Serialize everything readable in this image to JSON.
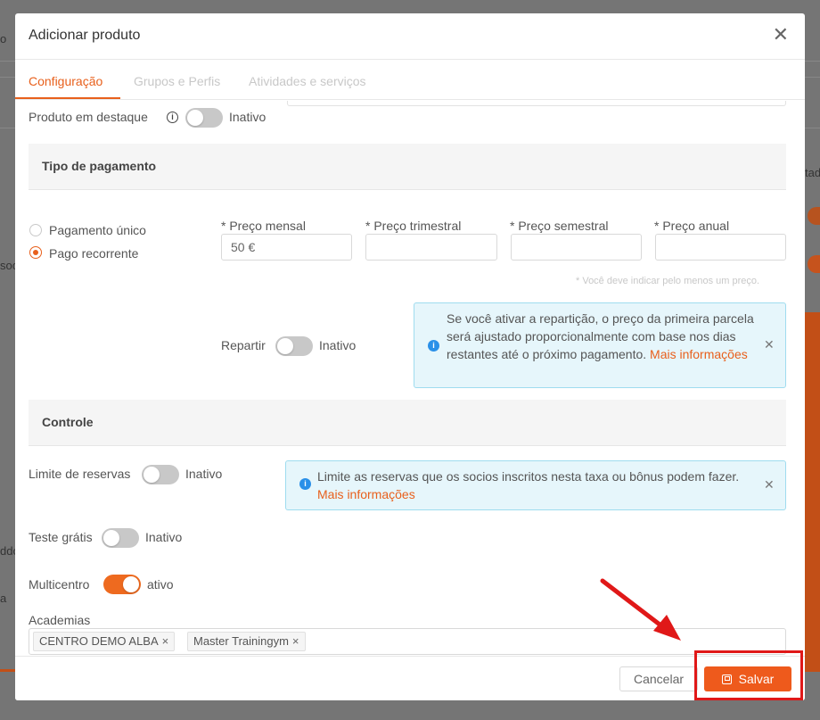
{
  "background": {
    "fragments": [
      {
        "text": "o",
        "id": "bg-text-1"
      },
      {
        "text": "soc",
        "id": "bg-text-2"
      },
      {
        "text": "tad",
        "id": "bg-text-3"
      },
      {
        "text": "ddo",
        "id": "bg-text-4"
      },
      {
        "text": "a",
        "id": "bg-text-5"
      }
    ]
  },
  "modal": {
    "title": "Adicionar produto",
    "close_symbol": "✕"
  },
  "tabs": [
    {
      "label": "Configuração",
      "active": true
    },
    {
      "label": "Grupos e Perfis",
      "active": false
    },
    {
      "label": "Atividades e serviços",
      "active": false
    }
  ],
  "featured": {
    "label": "Produto em destaque",
    "info_icon": "info-circle-icon",
    "state": "Inativo"
  },
  "payment_section": {
    "title": "Tipo de pagamento",
    "options": [
      {
        "label": "Pagamento único",
        "checked": false
      },
      {
        "label": "Pago recorrente",
        "checked": true
      }
    ],
    "prices": [
      {
        "label": "* Preço mensal",
        "value": "50 €"
      },
      {
        "label": "* Preço trimestral",
        "value": ""
      },
      {
        "label": "* Preço semestral",
        "value": ""
      },
      {
        "label": "* Preço anual",
        "value": ""
      }
    ],
    "hint": "* Você deve indicar pelo menos um preço.",
    "split_label": "Repartir",
    "split_state": "Inativo",
    "split_alert": {
      "text": "Se você ativar a repartição, o preço da primeira parcela será ajustado proporcionalmente com base nos dias restantes até o próximo pagamento.",
      "link": "Mais informações"
    }
  },
  "control_section": {
    "title": "Controle",
    "booking_limit_label": "Limite de reservas",
    "booking_limit_state": "Inativo",
    "booking_alert": {
      "text": "Limite as reservas que os socios inscritos nesta taxa ou bônus podem fazer.",
      "link": "Mais informações"
    },
    "trial_label": "Teste grátis",
    "trial_state": "Inativo",
    "multicenter_label": "Multicentro",
    "multicenter_state": "ativo",
    "academies_label": "Academias",
    "academies": [
      {
        "label": "CENTRO DEMO ALBA",
        "remove": "×"
      },
      {
        "label": "Master Trainingym",
        "remove": "×"
      }
    ]
  },
  "footer": {
    "cancel_label": "Cancelar",
    "save_label": "Salvar"
  },
  "colors": {
    "accent": "#e8601c",
    "annotation_red": "#e01818",
    "info_blue": "#2a90e8"
  }
}
